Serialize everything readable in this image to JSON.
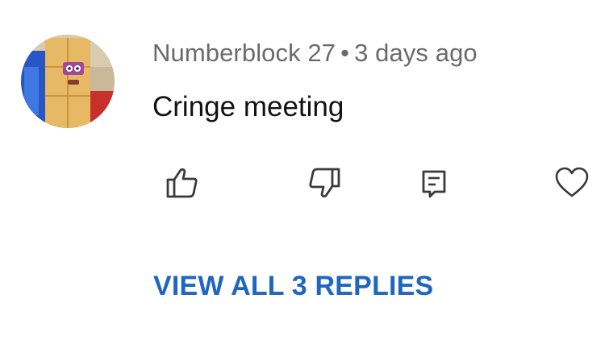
{
  "comment": {
    "author": "Numberblock 27",
    "separator": "•",
    "time": "3 days ago",
    "text": "Cringe meeting",
    "avatar_icon": "numberblock-avatar-icon",
    "actions": {
      "like_icon": "thumbs-up-icon",
      "dislike_icon": "thumbs-down-icon",
      "reply_icon": "reply-comment-icon",
      "heart_icon": "heart-icon"
    },
    "view_replies_label": "VIEW ALL 3 REPLIES"
  },
  "colors": {
    "meta": "#6b6b6b",
    "text": "#121212",
    "link": "#1f66c1",
    "icon": "#3a3a3a"
  }
}
